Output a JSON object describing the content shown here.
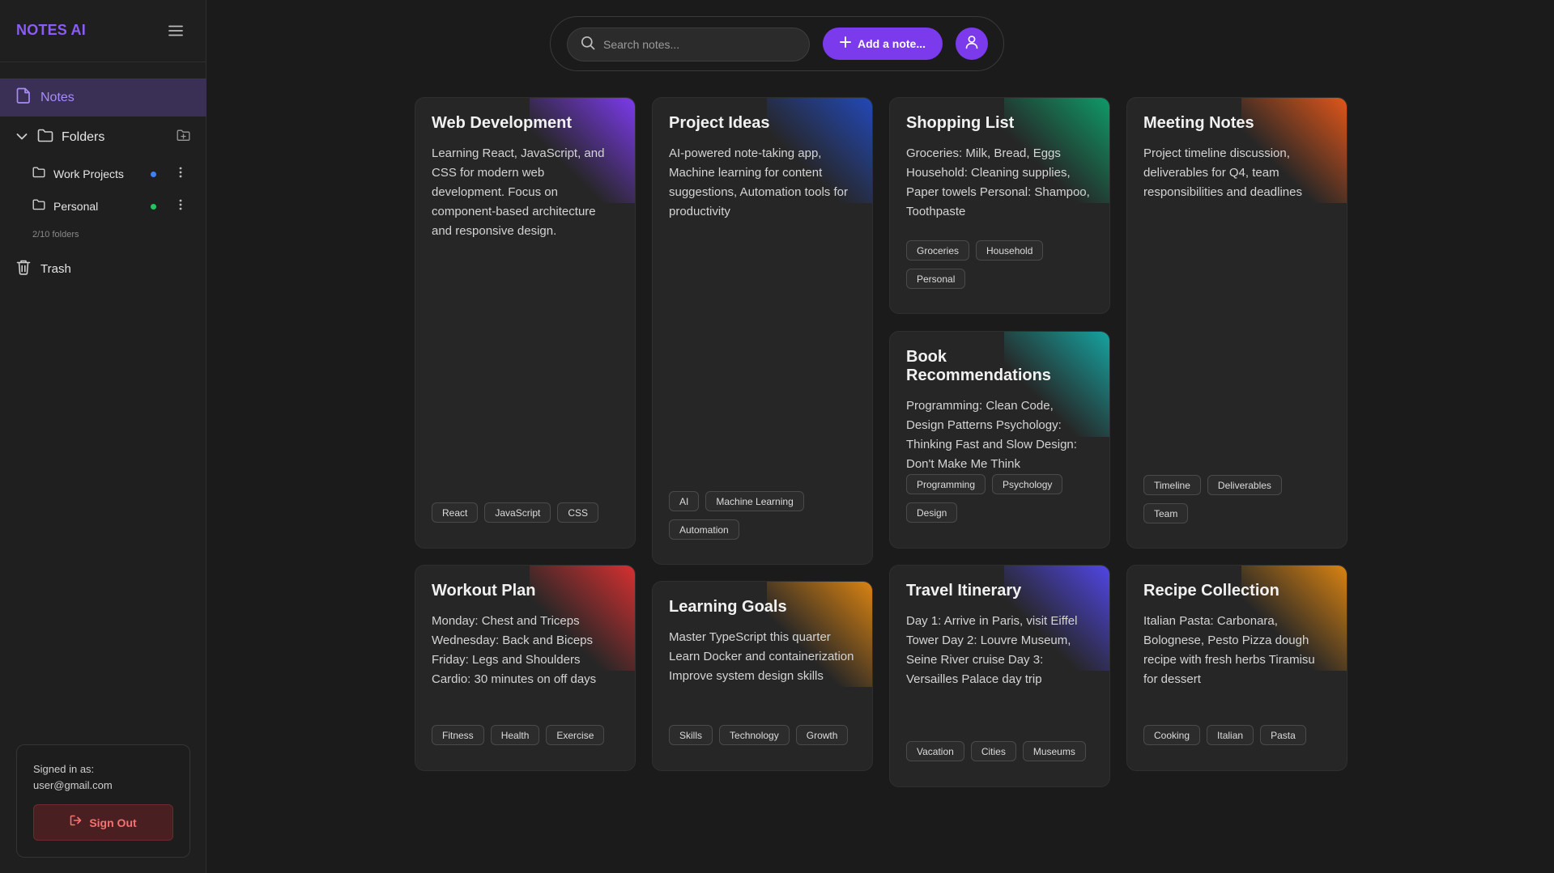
{
  "app": {
    "name": "NOTES AI"
  },
  "sidebar": {
    "notes_label": "Notes",
    "folders_label": "Folders",
    "folders": [
      {
        "name": "Work Projects",
        "color": "#3b82f6"
      },
      {
        "name": "Personal",
        "color": "#22c55e"
      }
    ],
    "folder_count": "2/10 folders",
    "trash_label": "Trash"
  },
  "user": {
    "signed_in_label": "Signed in as:",
    "email": "user@gmail.com",
    "sign_out_label": "Sign Out"
  },
  "topbar": {
    "search_placeholder": "Search notes...",
    "add_label": "Add a note..."
  },
  "colors": {
    "accent": "#7c3aed",
    "purple": "#7c3aed",
    "blue": "#2348b8",
    "green": "#0f9a68",
    "orange": "#e0561a",
    "teal": "#16a3a0",
    "red": "#d63031",
    "amber": "#d98312",
    "indigo": "#5046e5"
  },
  "notes": [
    {
      "title": "Web Development",
      "body": "Learning React, JavaScript, and CSS for modern web development. Focus on component-based architecture and responsive design.",
      "tags": [
        "React",
        "JavaScript",
        "CSS"
      ],
      "accent": "purple"
    },
    {
      "title": "Project Ideas",
      "body": "AI-powered note-taking app, Machine learning for content suggestions, Automation tools for productivity",
      "tags": [
        "AI",
        "Machine Learning",
        "Automation"
      ],
      "accent": "blue"
    },
    {
      "title": "Shopping List",
      "body": "Groceries: Milk, Bread, Eggs Household: Cleaning supplies, Paper towels Personal: Shampoo, Toothpaste",
      "tags": [
        "Groceries",
        "Household",
        "Personal"
      ],
      "accent": "green"
    },
    {
      "title": "Meeting Notes",
      "body": "Project timeline discussion, deliverables for Q4, team responsibilities and deadlines",
      "tags": [
        "Timeline",
        "Deliverables",
        "Team"
      ],
      "accent": "orange"
    },
    {
      "title": "Book Recommendations",
      "body": "Programming: Clean Code, Design Patterns Psychology: Thinking Fast and Slow Design: Don't Make Me Think",
      "tags": [
        "Programming",
        "Psychology",
        "Design"
      ],
      "accent": "teal"
    },
    {
      "title": "Workout Plan",
      "body": "Monday: Chest and Triceps Wednesday: Back and Biceps Friday: Legs and Shoulders Cardio: 30 minutes on off days",
      "tags": [
        "Fitness",
        "Health",
        "Exercise"
      ],
      "accent": "red"
    },
    {
      "title": "Learning Goals",
      "body": "Master TypeScript this quarter Learn Docker and containerization Improve system design skills",
      "tags": [
        "Skills",
        "Technology",
        "Growth"
      ],
      "accent": "amber"
    },
    {
      "title": "Travel Itinerary",
      "body": "Day 1: Arrive in Paris, visit Eiffel Tower Day 2: Louvre Museum, Seine River cruise Day 3: Versailles Palace day trip",
      "tags": [
        "Vacation",
        "Cities",
        "Museums"
      ],
      "accent": "indigo"
    },
    {
      "title": "Recipe Collection",
      "body": "Italian Pasta: Carbonara, Bolognese, Pesto Pizza dough recipe with fresh herbs Tiramisu for dessert",
      "tags": [
        "Cooking",
        "Italian",
        "Pasta"
      ],
      "accent": "amber"
    }
  ]
}
